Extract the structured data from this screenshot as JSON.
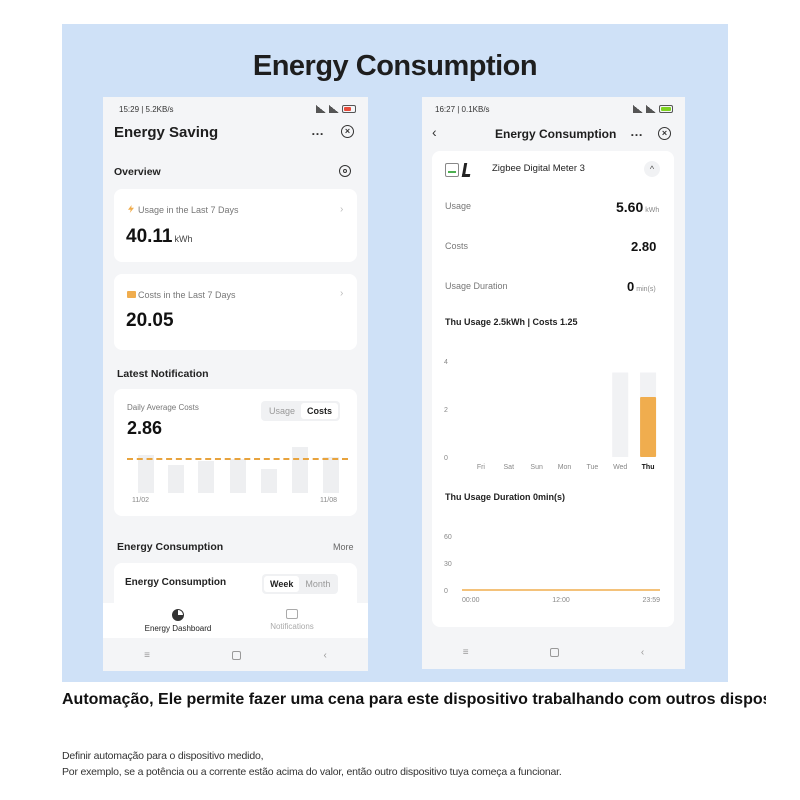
{
  "banner": {
    "title": "Energy Consumption"
  },
  "phone1": {
    "status_time": "15:29 | 5.2KB/s",
    "title": "Energy Saving",
    "more_icon": "…",
    "overview": {
      "heading": "Overview",
      "usage_label": "Usage in the Last 7 Days",
      "usage_value": "40.11",
      "usage_unit": "kWh",
      "costs_label": "Costs in the Last 7 Days",
      "costs_value": "20.05"
    },
    "latest_notification": {
      "heading": "Latest Notification",
      "daily_label": "Daily Average Costs",
      "daily_value": "2.86",
      "toggle": [
        "Usage",
        "Costs"
      ],
      "selected": "Costs",
      "x_start": "11/02",
      "x_end": "11/08"
    },
    "energy_consumption": {
      "heading": "Energy Consumption",
      "more": "More",
      "card_title": "Energy Consumption",
      "toggle": [
        "Week",
        "Month"
      ],
      "selected": "Week"
    },
    "tabs": {
      "dashboard": "Energy Dashboard",
      "notifications": "Notifications"
    },
    "colors": {
      "accent": "#e8a33d",
      "battery": "#e74c3c"
    }
  },
  "phone2": {
    "status_time": "16:27 | 0.1KB/s",
    "title": "Energy Consumption",
    "more_icon": "…",
    "device_name": "Zigbee Digital Meter 3",
    "usage_label": "Usage",
    "usage_value": "5.60",
    "usage_unit": "kWh",
    "costs_label": "Costs",
    "costs_value": "2.80",
    "duration_label": "Usage Duration",
    "duration_value": "0",
    "duration_unit": "min(s)",
    "chart1_title": "Thu Usage 2.5kWh | Costs 1.25",
    "chart2_title": "Thu Usage Duration 0min(s)",
    "colors": {
      "accent": "#f0ad4e",
      "battery": "#7ed321"
    }
  },
  "chart_data": [
    {
      "type": "bar",
      "title": "Thu Usage 2.5kWh | Costs 1.25",
      "categories": [
        "Fri",
        "Sat",
        "Sun",
        "Mon",
        "Tue",
        "Wed",
        "Thu"
      ],
      "values": [
        0,
        0,
        0,
        0,
        0,
        0,
        2.5
      ],
      "y_ticks": [
        "0",
        "2",
        "4"
      ],
      "ylim": [
        0,
        4
      ],
      "highlight": "Thu"
    },
    {
      "type": "line",
      "title": "Thu Usage Duration 0min(s)",
      "x_ticks": [
        "00:00",
        "12:00",
        "23:59"
      ],
      "y_ticks": [
        "0",
        "30",
        "60"
      ],
      "ylim": [
        0,
        60
      ],
      "values": [
        0,
        0,
        0
      ]
    }
  ],
  "caption": {
    "title": "Automação, Ele permite fazer uma cena para este dispositivo trabalhando com outros dispositivos tuya",
    "line1": "Definir automação para o dispositivo medido,",
    "line2": "Por exemplo, se a potência ou a corrente estão acima do valor, então outro dispositivo tuya começa a funcionar."
  }
}
